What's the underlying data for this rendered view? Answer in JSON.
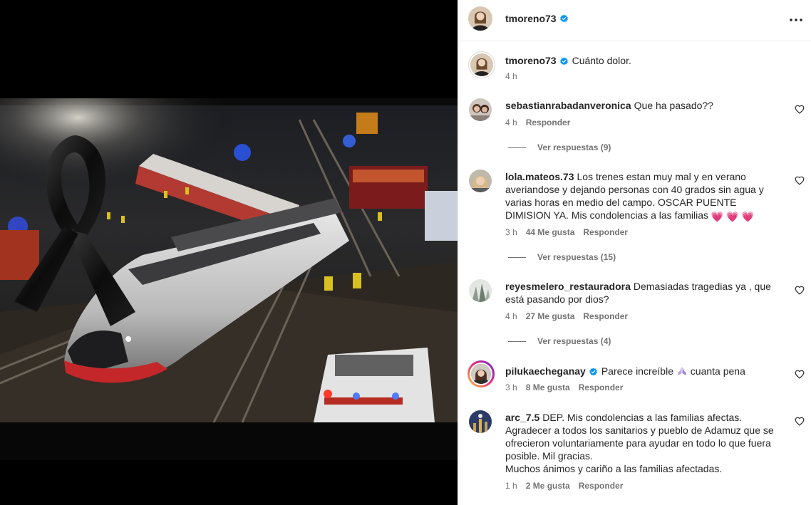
{
  "post": {
    "author": "tmoreno73",
    "caption": "Cuánto dolor.",
    "caption_time": "4 h"
  },
  "comments": [
    {
      "username": "sebastianrabadanveronica",
      "text": "Que ha pasado??",
      "time": "4 h",
      "likes": "",
      "reply_label": "Responder",
      "view_replies": "Ver respuestas (9)"
    },
    {
      "username": "lola.mateos.73",
      "text": "Los trenes estan muy mal y en verano averiandose y dejando personas con 40 grados sin agua y varias horas en medio del campo. OSCAR PUENTE DIMISION YA. Mis condolencias a las familias",
      "emoji": "💗 💗 💗",
      "time": "3 h",
      "likes": "44 Me gusta",
      "reply_label": "Responder",
      "view_replies": "Ver respuestas (15)"
    },
    {
      "username": "reyesmelero_restauradora",
      "text": "Demasiadas tragedias ya , que está pasando por dios?",
      "time": "4 h",
      "likes": "27 Me gusta",
      "reply_label": "Responder",
      "view_replies": "Ver respuestas (4)"
    },
    {
      "username": "pilukaecheganay",
      "text_before": "Parece increíble",
      "text_after": "cuanta pena",
      "time": "3 h",
      "likes": "8 Me gusta",
      "reply_label": "Responder"
    },
    {
      "username": "arc_7.5",
      "text": "DEP. Mis condolencias a las familias afectas. Agradecer a todos los sanitarios y pueblo de Adamuz que se ofrecieron voluntariamente para ayudar en todo lo que fuera posible. Mil gracias.",
      "text2": "Muchos ánimos y cariño a las familias afectadas.",
      "time": "1 h",
      "likes": "2 Me gusta",
      "reply_label": "Responder"
    }
  ],
  "colors": {
    "verified": "#0095f6",
    "text": "#262626",
    "secondary": "#737373",
    "heart_emoji": "#e83e8c"
  },
  "icons": {
    "mute": "volume-icon",
    "more": "more-options-icon",
    "like": "heart-outline-icon",
    "verified": "verified-badge-icon"
  }
}
